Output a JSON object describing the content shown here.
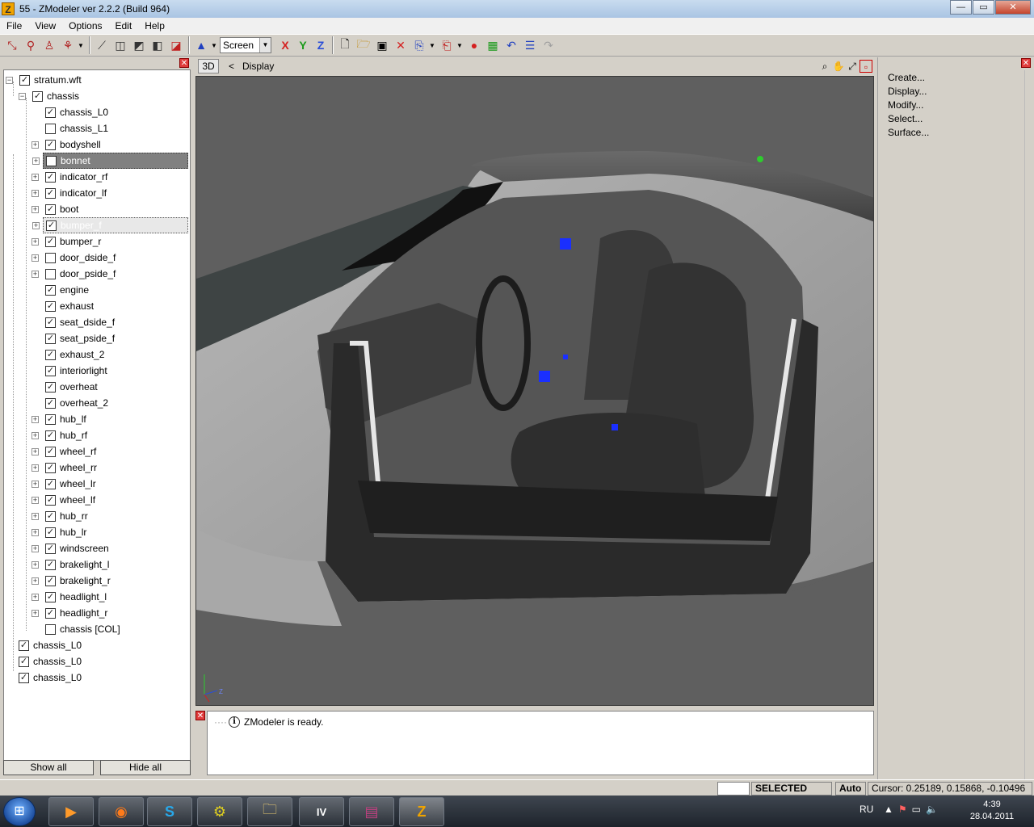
{
  "window": {
    "title": "55 - ZModeler ver 2.2.2 (Build 964)",
    "app_icon_letter": "Z",
    "controls": {
      "minimize": "—",
      "maximize": "▭",
      "close": "✕"
    }
  },
  "menu": [
    "File",
    "View",
    "Options",
    "Edit",
    "Help"
  ],
  "toolbar": {
    "screen_value": "Screen",
    "axes": [
      {
        "label": "X",
        "color": "#d42020"
      },
      {
        "label": "Y",
        "color": "#1a9a1a"
      },
      {
        "label": "Z",
        "color": "#2a4ed8"
      }
    ]
  },
  "tree": {
    "root": "stratum.wft",
    "group": "chassis",
    "children": [
      {
        "label": "chassis_L0",
        "checked": true,
        "expandable": false
      },
      {
        "label": "chassis_L1",
        "checked": false,
        "expandable": false
      },
      {
        "label": "bodyshell",
        "checked": true,
        "expandable": true
      },
      {
        "label": "bonnet",
        "checked": false,
        "expandable": true,
        "selected": "dark"
      },
      {
        "label": "indicator_rf",
        "checked": true,
        "expandable": true
      },
      {
        "label": "indicator_lf",
        "checked": true,
        "expandable": true
      },
      {
        "label": "boot",
        "checked": true,
        "expandable": true
      },
      {
        "label": "bumper_f",
        "checked": true,
        "expandable": true,
        "selected": "light"
      },
      {
        "label": "bumper_r",
        "checked": true,
        "expandable": true
      },
      {
        "label": "door_dside_f",
        "checked": false,
        "expandable": true
      },
      {
        "label": "door_pside_f",
        "checked": false,
        "expandable": true
      },
      {
        "label": "engine",
        "checked": true,
        "expandable": false
      },
      {
        "label": "exhaust",
        "checked": true,
        "expandable": false
      },
      {
        "label": "seat_dside_f",
        "checked": true,
        "expandable": false
      },
      {
        "label": "seat_pside_f",
        "checked": true,
        "expandable": false
      },
      {
        "label": "exhaust_2",
        "checked": true,
        "expandable": false
      },
      {
        "label": "interiorlight",
        "checked": true,
        "expandable": false
      },
      {
        "label": "overheat",
        "checked": true,
        "expandable": false
      },
      {
        "label": "overheat_2",
        "checked": true,
        "expandable": false
      },
      {
        "label": "hub_lf",
        "checked": true,
        "expandable": true
      },
      {
        "label": "hub_rf",
        "checked": true,
        "expandable": true
      },
      {
        "label": "wheel_rf",
        "checked": true,
        "expandable": true
      },
      {
        "label": "wheel_rr",
        "checked": true,
        "expandable": true
      },
      {
        "label": "wheel_lr",
        "checked": true,
        "expandable": true
      },
      {
        "label": "wheel_lf",
        "checked": true,
        "expandable": true
      },
      {
        "label": "hub_rr",
        "checked": true,
        "expandable": true
      },
      {
        "label": "hub_lr",
        "checked": true,
        "expandable": true
      },
      {
        "label": "windscreen",
        "checked": true,
        "expandable": true
      },
      {
        "label": "brakelight_l",
        "checked": true,
        "expandable": true
      },
      {
        "label": "brakelight_r",
        "checked": true,
        "expandable": true
      },
      {
        "label": "headlight_l",
        "checked": true,
        "expandable": true
      },
      {
        "label": "headlight_r",
        "checked": true,
        "expandable": true
      },
      {
        "label": "chassis [COL]",
        "checked": false,
        "expandable": false
      }
    ],
    "top_level": [
      "chassis_L0",
      "chassis_L0",
      "chassis_L0"
    ],
    "show_all": "Show all",
    "hide_all": "Hide all"
  },
  "viewport": {
    "mode_button": "3D",
    "view_label": "Display",
    "arrow": "<",
    "axis_z": "Z"
  },
  "log": {
    "message": "ZModeler is ready."
  },
  "commands": [
    "Create...",
    "Display...",
    "Modify...",
    "Select...",
    "Surface..."
  ],
  "status": {
    "mode": "SELECTED MODE",
    "auto": "Auto",
    "cursor": "Cursor: 0.25189, 0.15868, -0.10496"
  },
  "taskbar": {
    "lang": "RU",
    "time": "4:39",
    "date": "28.04.2011"
  }
}
